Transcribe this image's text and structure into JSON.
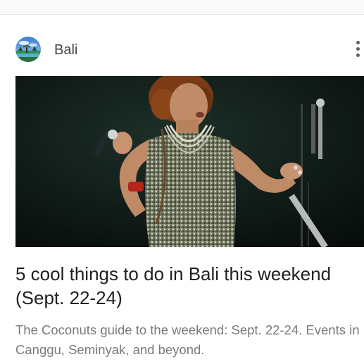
{
  "card": {
    "source": {
      "name": "Bali",
      "avatar_icon": "bali-landscape-avatar"
    },
    "menu": {
      "icon": "more-vertical-icon"
    },
    "image": {
      "subject": "singer-on-stage-photo"
    },
    "headline": "5 cool things to do in Bali this weekend (Sept. 22-24)",
    "snippet": "The Coconuts guide to the weekend: Sept. 22-24. Events in Canggu, Seminyak, and beyond."
  },
  "colors": {
    "headline": "#212121",
    "snippet": "#7a7a7a",
    "source": "#444444",
    "divider": "#e4e4e4",
    "photo_background": "#0c1613"
  }
}
